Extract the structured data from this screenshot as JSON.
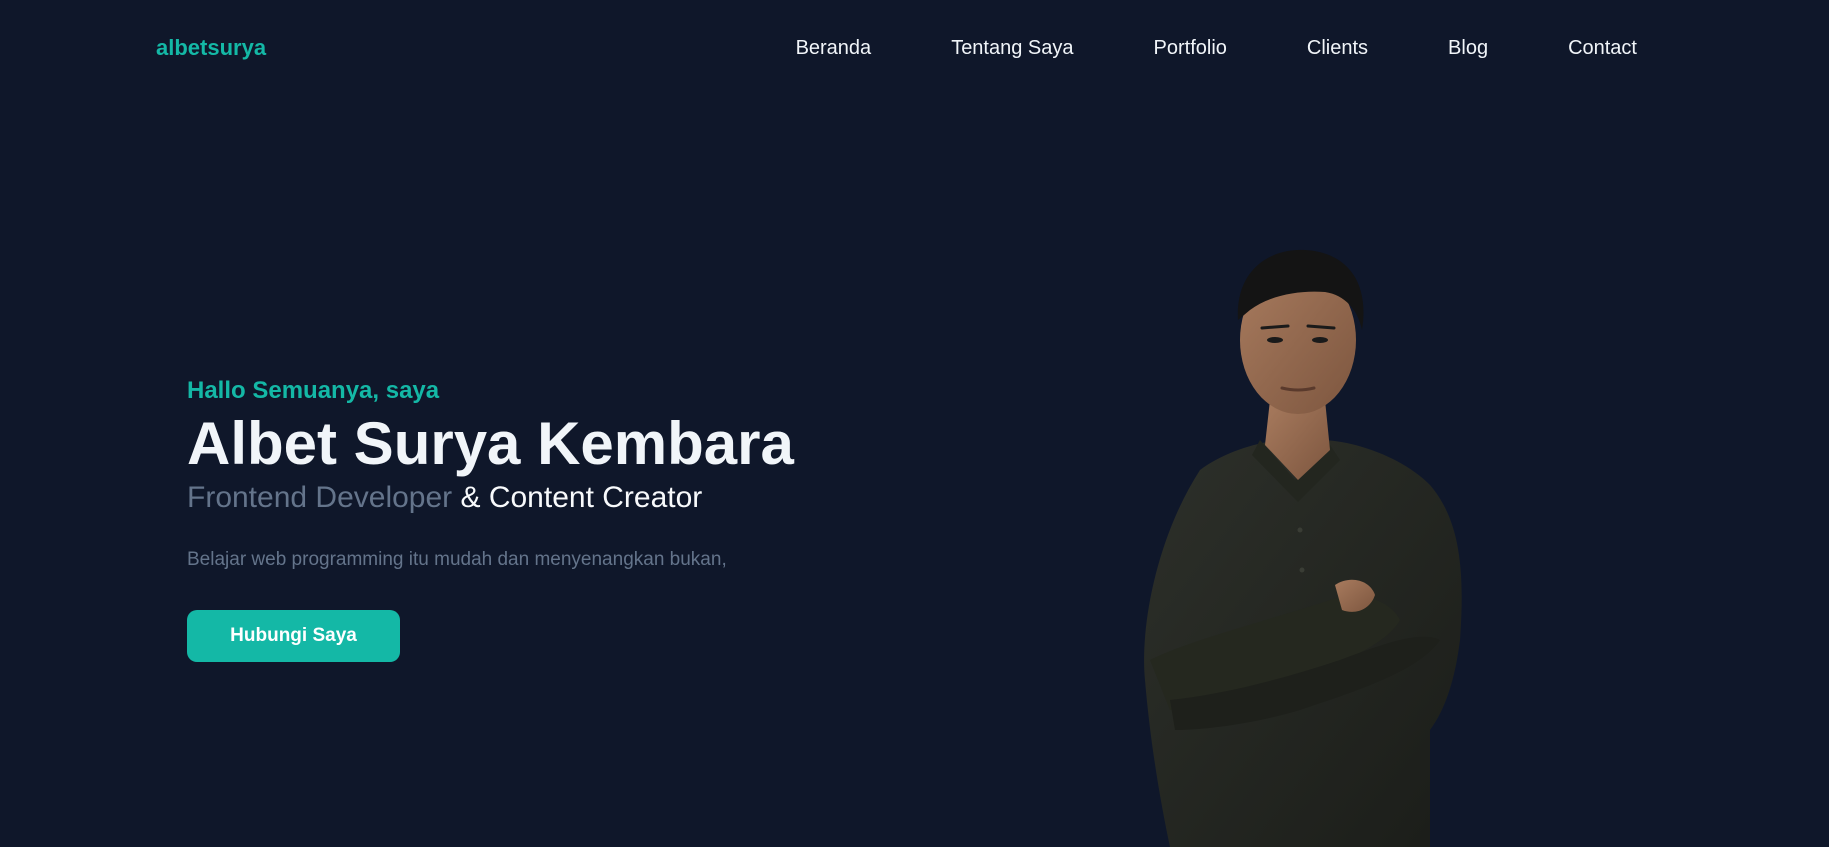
{
  "header": {
    "logo": "albetsurya",
    "nav": [
      {
        "label": "Beranda"
      },
      {
        "label": "Tentang Saya"
      },
      {
        "label": "Portfolio"
      },
      {
        "label": "Clients"
      },
      {
        "label": "Blog"
      },
      {
        "label": "Contact"
      }
    ]
  },
  "hero": {
    "greeting": "Hallo Semuanya, saya",
    "name": "Albet Surya Kembara",
    "role_primary": "Frontend Developer",
    "role_secondary": " & Content Creator",
    "tagline": "Belajar web programming itu mudah dan menyenangkan bukan,",
    "cta_label": "Hubungi Saya"
  },
  "colors": {
    "background": "#0f172a",
    "accent": "#14b8a6",
    "muted": "#64748b",
    "text": "#f1f5f9"
  }
}
